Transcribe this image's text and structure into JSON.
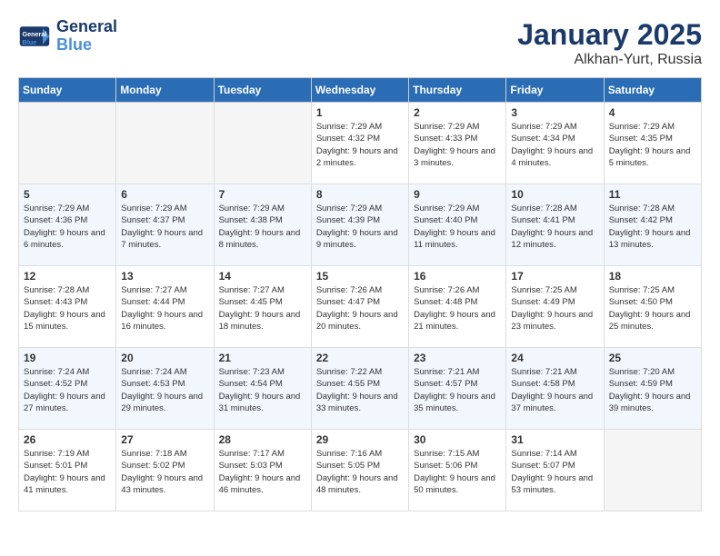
{
  "header": {
    "logo_line1": "General",
    "logo_line2": "Blue",
    "month": "January 2025",
    "location": "Alkhan-Yurt, Russia"
  },
  "days_of_week": [
    "Sunday",
    "Monday",
    "Tuesday",
    "Wednesday",
    "Thursday",
    "Friday",
    "Saturday"
  ],
  "weeks": [
    [
      {
        "day": "",
        "empty": true
      },
      {
        "day": "",
        "empty": true
      },
      {
        "day": "",
        "empty": true
      },
      {
        "day": "1",
        "sunrise": "7:29 AM",
        "sunset": "4:32 PM",
        "daylight": "9 hours and 2 minutes."
      },
      {
        "day": "2",
        "sunrise": "7:29 AM",
        "sunset": "4:33 PM",
        "daylight": "9 hours and 3 minutes."
      },
      {
        "day": "3",
        "sunrise": "7:29 AM",
        "sunset": "4:34 PM",
        "daylight": "9 hours and 4 minutes."
      },
      {
        "day": "4",
        "sunrise": "7:29 AM",
        "sunset": "4:35 PM",
        "daylight": "9 hours and 5 minutes."
      }
    ],
    [
      {
        "day": "5",
        "sunrise": "7:29 AM",
        "sunset": "4:36 PM",
        "daylight": "9 hours and 6 minutes."
      },
      {
        "day": "6",
        "sunrise": "7:29 AM",
        "sunset": "4:37 PM",
        "daylight": "9 hours and 7 minutes."
      },
      {
        "day": "7",
        "sunrise": "7:29 AM",
        "sunset": "4:38 PM",
        "daylight": "9 hours and 8 minutes."
      },
      {
        "day": "8",
        "sunrise": "7:29 AM",
        "sunset": "4:39 PM",
        "daylight": "9 hours and 9 minutes."
      },
      {
        "day": "9",
        "sunrise": "7:29 AM",
        "sunset": "4:40 PM",
        "daylight": "9 hours and 11 minutes."
      },
      {
        "day": "10",
        "sunrise": "7:28 AM",
        "sunset": "4:41 PM",
        "daylight": "9 hours and 12 minutes."
      },
      {
        "day": "11",
        "sunrise": "7:28 AM",
        "sunset": "4:42 PM",
        "daylight": "9 hours and 13 minutes."
      }
    ],
    [
      {
        "day": "12",
        "sunrise": "7:28 AM",
        "sunset": "4:43 PM",
        "daylight": "9 hours and 15 minutes."
      },
      {
        "day": "13",
        "sunrise": "7:27 AM",
        "sunset": "4:44 PM",
        "daylight": "9 hours and 16 minutes."
      },
      {
        "day": "14",
        "sunrise": "7:27 AM",
        "sunset": "4:45 PM",
        "daylight": "9 hours and 18 minutes."
      },
      {
        "day": "15",
        "sunrise": "7:26 AM",
        "sunset": "4:47 PM",
        "daylight": "9 hours and 20 minutes."
      },
      {
        "day": "16",
        "sunrise": "7:26 AM",
        "sunset": "4:48 PM",
        "daylight": "9 hours and 21 minutes."
      },
      {
        "day": "17",
        "sunrise": "7:25 AM",
        "sunset": "4:49 PM",
        "daylight": "9 hours and 23 minutes."
      },
      {
        "day": "18",
        "sunrise": "7:25 AM",
        "sunset": "4:50 PM",
        "daylight": "9 hours and 25 minutes."
      }
    ],
    [
      {
        "day": "19",
        "sunrise": "7:24 AM",
        "sunset": "4:52 PM",
        "daylight": "9 hours and 27 minutes."
      },
      {
        "day": "20",
        "sunrise": "7:24 AM",
        "sunset": "4:53 PM",
        "daylight": "9 hours and 29 minutes."
      },
      {
        "day": "21",
        "sunrise": "7:23 AM",
        "sunset": "4:54 PM",
        "daylight": "9 hours and 31 minutes."
      },
      {
        "day": "22",
        "sunrise": "7:22 AM",
        "sunset": "4:55 PM",
        "daylight": "9 hours and 33 minutes."
      },
      {
        "day": "23",
        "sunrise": "7:21 AM",
        "sunset": "4:57 PM",
        "daylight": "9 hours and 35 minutes."
      },
      {
        "day": "24",
        "sunrise": "7:21 AM",
        "sunset": "4:58 PM",
        "daylight": "9 hours and 37 minutes."
      },
      {
        "day": "25",
        "sunrise": "7:20 AM",
        "sunset": "4:59 PM",
        "daylight": "9 hours and 39 minutes."
      }
    ],
    [
      {
        "day": "26",
        "sunrise": "7:19 AM",
        "sunset": "5:01 PM",
        "daylight": "9 hours and 41 minutes."
      },
      {
        "day": "27",
        "sunrise": "7:18 AM",
        "sunset": "5:02 PM",
        "daylight": "9 hours and 43 minutes."
      },
      {
        "day": "28",
        "sunrise": "7:17 AM",
        "sunset": "5:03 PM",
        "daylight": "9 hours and 46 minutes."
      },
      {
        "day": "29",
        "sunrise": "7:16 AM",
        "sunset": "5:05 PM",
        "daylight": "9 hours and 48 minutes."
      },
      {
        "day": "30",
        "sunrise": "7:15 AM",
        "sunset": "5:06 PM",
        "daylight": "9 hours and 50 minutes."
      },
      {
        "day": "31",
        "sunrise": "7:14 AM",
        "sunset": "5:07 PM",
        "daylight": "9 hours and 53 minutes."
      },
      {
        "day": "",
        "empty": true
      }
    ]
  ]
}
